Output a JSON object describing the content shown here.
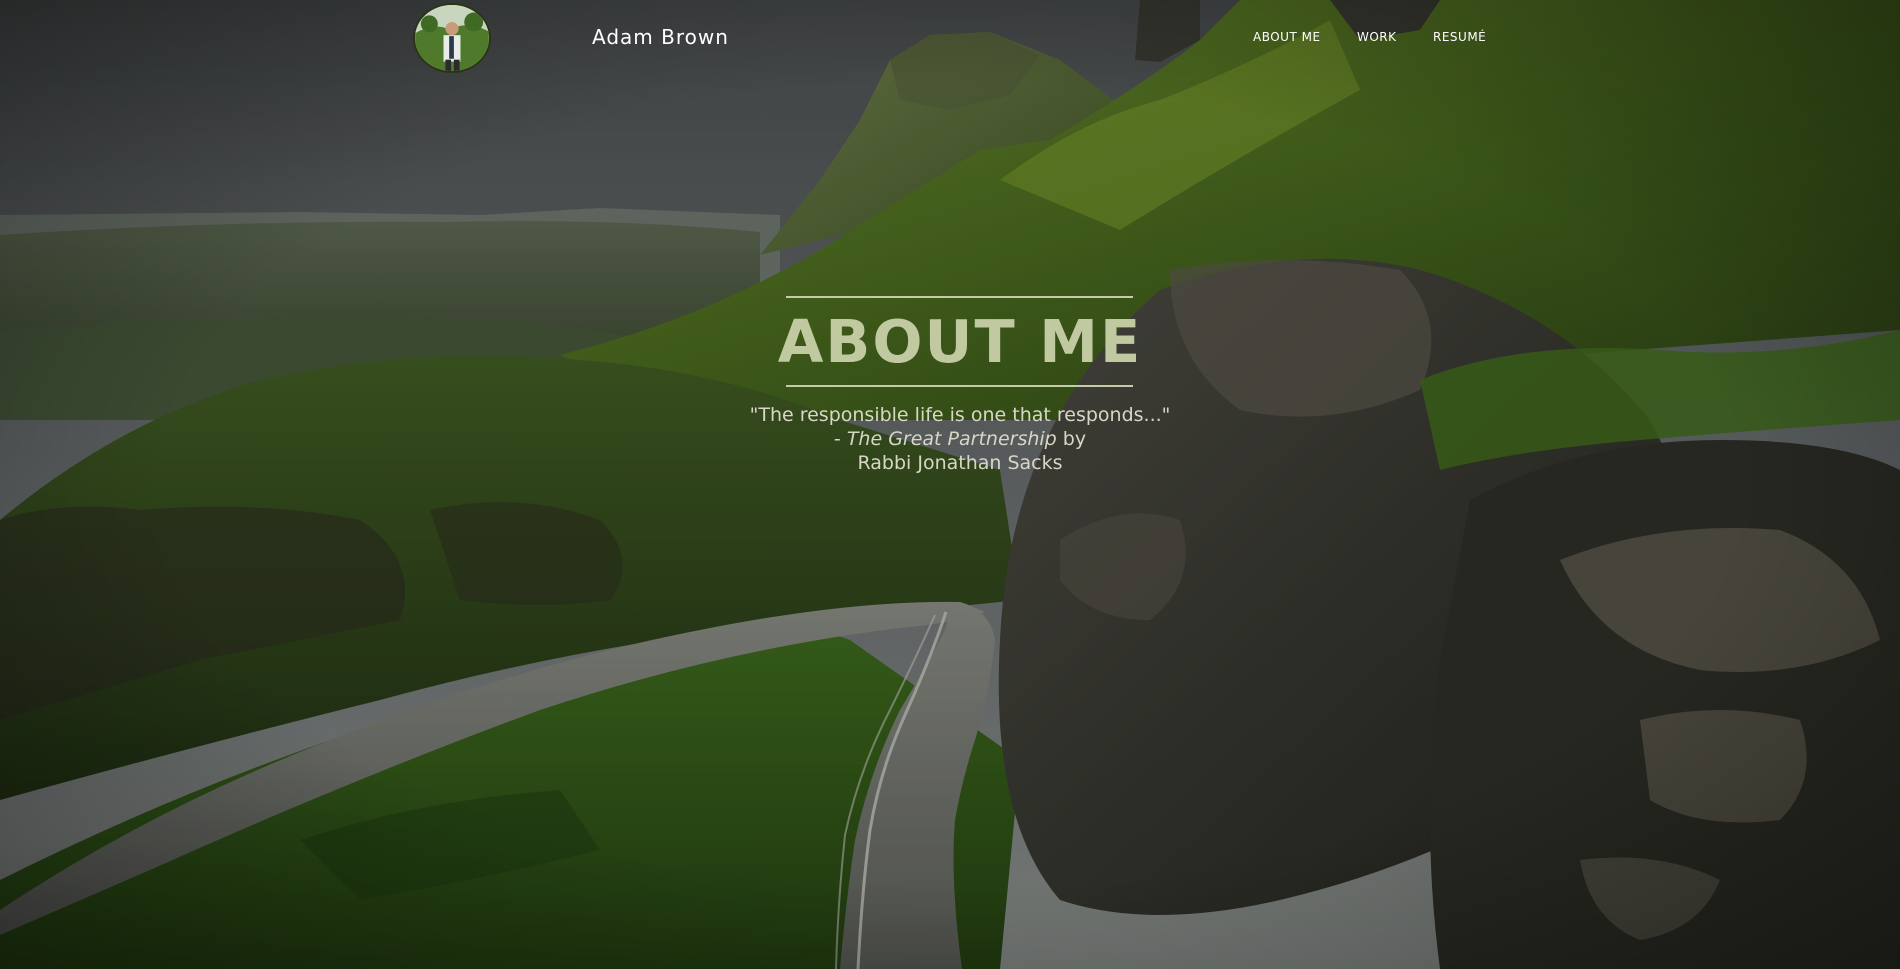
{
  "header": {
    "site_name": "Adam Brown",
    "nav": [
      {
        "label": "ABOUT ME"
      },
      {
        "label": "WORK"
      },
      {
        "label": "RESUMÉ"
      }
    ]
  },
  "hero": {
    "title": "ABOUT ME",
    "quote_line": "\"The responsible life is one that responds...\"",
    "attribution_prefix": "- ",
    "book_title": "The Great Partnership",
    "attribution_by": " by",
    "author": "Rabbi Jonathan Sacks"
  },
  "colors": {
    "title": "#c1c9a1",
    "rule": "#c3cca4",
    "quote": "#d8d6c6",
    "nav": "#ffffff"
  },
  "icons": {
    "avatar": "profile-photo"
  }
}
